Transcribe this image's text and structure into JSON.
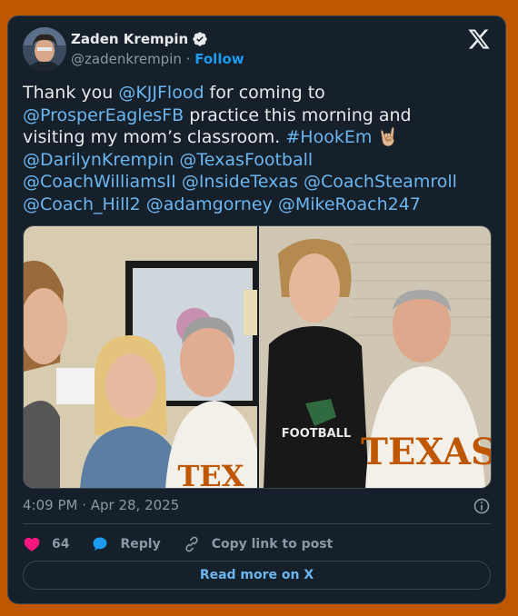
{
  "author": {
    "name": "Zaden Krempin",
    "handle": "@zadenkrempin",
    "separator": "·",
    "follow_label": "Follow"
  },
  "tweet": {
    "line1_pre": "Thank you ",
    "line1_mention": "@KJJFlood",
    "line1_post": " for coming to",
    "line2_mention": "@ProsperEaglesFB",
    "line2_post": " practice this morning and",
    "line3_pre": "visiting my mom’s classroom. ",
    "line3_hashtag": "#HookEm",
    "line3_emoji": "🤘🏼",
    "line4_mention1": "@DarilynKrempin",
    "line4_mention2": "@TexasFootball",
    "line5_mention1": "@CoachWilliamsII",
    "line5_mention2": "@InsideTexas",
    "line5_mention3": "@CoachSteamroll",
    "line6_mention1": "@Coach_Hill2",
    "line6_mention2": "@adamgorney",
    "line6_mention3": "@MikeRoach247"
  },
  "media": {
    "left_jersey_text": "TEX",
    "right_shirt_text": "FOOTBALL",
    "right_jersey_text": "TEXAS"
  },
  "meta": {
    "timestamp": "4:09 PM · Apr 28, 2025"
  },
  "actions": {
    "like_count": "64",
    "reply_label": "Reply",
    "copy_label": "Copy link to post"
  },
  "footer": {
    "read_more_label": "Read more on X"
  },
  "colors": {
    "page_bg": "#bf5700",
    "card_bg": "#15202b",
    "link": "#6cb6f0",
    "heart": "#f91880"
  }
}
